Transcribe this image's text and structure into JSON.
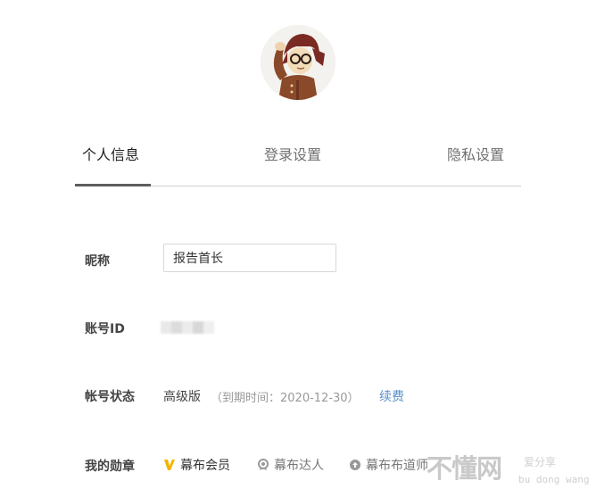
{
  "tabs": [
    {
      "label": "个人信息",
      "active": true
    },
    {
      "label": "登录设置",
      "active": false
    },
    {
      "label": "隐私设置",
      "active": false
    }
  ],
  "profile": {
    "nickname_label": "昵称",
    "nickname_value": "报告首长",
    "account_id_label": "账号ID",
    "status_label": "帐号状态",
    "status_value": "高级版",
    "status_expiry": "（到期时间：2020-12-30）",
    "renew_label": "续费",
    "badges_label": "我的勋章",
    "badges": [
      {
        "label": "幕布会员",
        "icon": "v-member-icon"
      },
      {
        "label": "幕布达人",
        "icon": "expert-medal-icon"
      },
      {
        "label": "幕布布道师",
        "icon": "mentor-medal-icon"
      }
    ]
  },
  "watermark": {
    "main": "不懂网",
    "sub1": "爱分享",
    "sub2": "bu dong wang"
  },
  "colors": {
    "link": "#5b8fc7",
    "active_tab_bar": "#5e5e5e",
    "vip_icon": "#f5b400"
  }
}
